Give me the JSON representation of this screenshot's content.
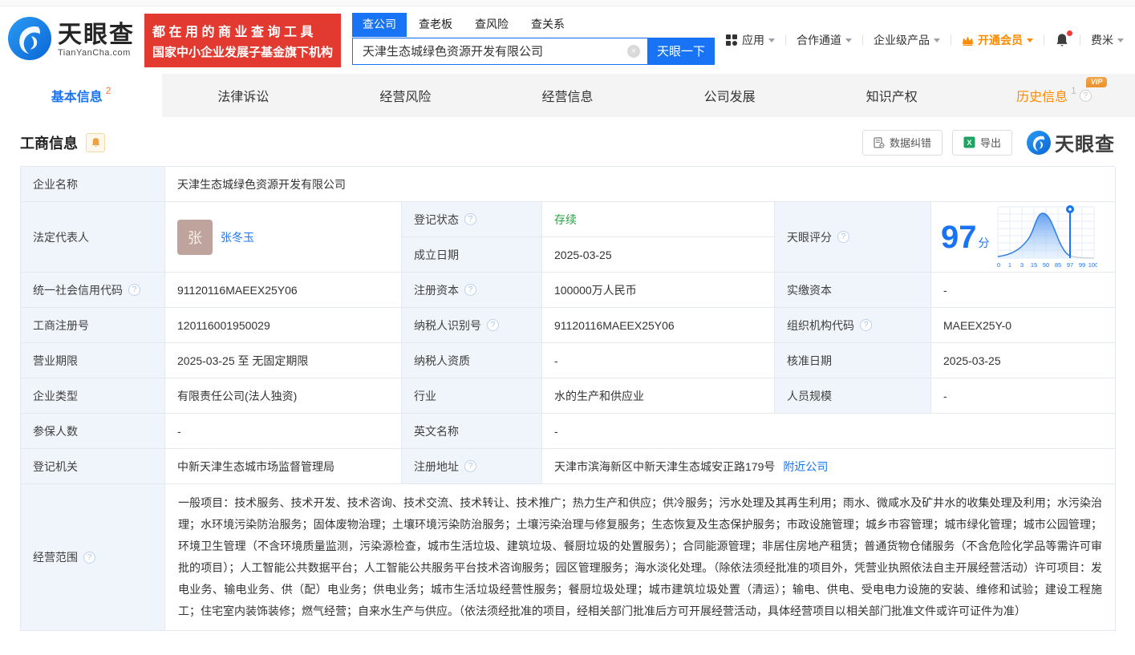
{
  "icons": {
    "help": "?",
    "clear": "×",
    "excel_x": "X"
  },
  "colors": {
    "primary_blue": "#1874f5",
    "banner_red": "#e23a30",
    "status_green": "#2ba245",
    "vip_orange": "#ff8a00",
    "avatar_brown": "#bea49c"
  },
  "header": {
    "brand": {
      "name": "天眼查",
      "domain": "TianYanCha.com"
    },
    "slogan": {
      "line1": "都在用的商业查询工具",
      "line2": "国家中小企业发展子基金旗下机构"
    },
    "search": {
      "tabs": [
        {
          "label": "查公司"
        },
        {
          "label": "查老板"
        },
        {
          "label": "查风险"
        },
        {
          "label": "查关系"
        }
      ],
      "query": "天津生态城绿色资源开发有限公司",
      "submit_label": "天眼一下"
    },
    "nav": {
      "apps": "应用",
      "partner": "合作通道",
      "enterprise": "企业级产品",
      "vip": "开通会员",
      "user": "费米"
    }
  },
  "tabbar": {
    "tabs": [
      {
        "label": "基本信息",
        "count": "2"
      },
      {
        "label": "法律诉讼"
      },
      {
        "label": "经营风险"
      },
      {
        "label": "经营信息"
      },
      {
        "label": "公司发展"
      },
      {
        "label": "知识产权"
      },
      {
        "label": "历史信息",
        "count": "1",
        "badge": "VIP"
      }
    ]
  },
  "section": {
    "title": "工商信息",
    "correct_label": "数据纠错",
    "export_label": "导出",
    "watermark": "天眼查"
  },
  "score": {
    "label": "天眼评分",
    "value": "97",
    "unit": "分",
    "axis": [
      "0",
      "1",
      "3",
      "15",
      "50",
      "85",
      "97",
      "99",
      "100"
    ]
  },
  "chart_data": {
    "type": "area",
    "title": "天眼评分分布曲线",
    "x_tick_labels": [
      "0",
      "1",
      "3",
      "15",
      "50",
      "85",
      "97",
      "99",
      "100"
    ],
    "marker_value": 97,
    "shape": "bell-curve"
  },
  "fields": {
    "company_name": {
      "label": "企业名称",
      "value": "天津生态城绿色资源开发有限公司"
    },
    "legal_rep": {
      "label": "法定代表人",
      "value": "张冬玉",
      "avatar": "张"
    },
    "reg_status": {
      "label": "登记状态",
      "value": "存续"
    },
    "est_date": {
      "label": "成立日期",
      "value": "2025-03-25"
    },
    "credit_code": {
      "label": "统一社会信用代码",
      "value": "91120116MAEEX25Y06"
    },
    "reg_capital": {
      "label": "注册资本",
      "value": "100000万人民币"
    },
    "paid_capital": {
      "label": "实缴资本",
      "value": "-"
    },
    "reg_number": {
      "label": "工商注册号",
      "value": "120116001950029"
    },
    "taxpayer_id": {
      "label": "纳税人识别号",
      "value": "91120116MAEEX25Y06"
    },
    "org_code": {
      "label": "组织机构代码",
      "value": "MAEEX25Y-0"
    },
    "business_term": {
      "label": "营业期限",
      "value": "2025-03-25 至 无固定期限"
    },
    "taxpayer_quality": {
      "label": "纳税人资质",
      "value": "-"
    },
    "approval_date": {
      "label": "核准日期",
      "value": "2025-03-25"
    },
    "company_type": {
      "label": "企业类型",
      "value": "有限责任公司(法人独资)"
    },
    "industry": {
      "label": "行业",
      "value": "水的生产和供应业"
    },
    "staff_size": {
      "label": "人员规模",
      "value": "-"
    },
    "insured_count": {
      "label": "参保人数",
      "value": "-"
    },
    "english_name": {
      "label": "英文名称",
      "value": "-"
    },
    "reg_authority": {
      "label": "登记机关",
      "value": "中新天津生态城市场监督管理局"
    },
    "reg_address": {
      "label": "注册地址",
      "value": "天津市滨海新区中新天津生态城安正路179号",
      "link": "附近公司"
    },
    "business_scope": {
      "label": "经营范围",
      "value": "一般项目：技术服务、技术开发、技术咨询、技术交流、技术转让、技术推广；热力生产和供应；供冷服务；污水处理及其再生利用；雨水、微咸水及矿井水的收集处理及利用；水污染治理；水环境污染防治服务；固体废物治理；土壤环境污染防治服务；土壤污染治理与修复服务；生态恢复及生态保护服务；市政设施管理；城乡市容管理；城市绿化管理；城市公园管理；环境卫生管理（不含环境质量监测，污染源检查，城市生活垃圾、建筑垃圾、餐厨垃圾的处置服务）；合同能源管理；非居住房地产租赁；普通货物仓储服务（不含危险化学品等需许可审批的项目）；人工智能公共数据平台；人工智能公共服务平台技术咨询服务；园区管理服务；海水淡化处理。（除依法须经批准的项目外，凭营业执照依法自主开展经营活动）许可项目：发电业务、输电业务、供（配）电业务；供电业务；城市生活垃圾经营性服务；餐厨垃圾处理；城市建筑垃圾处置（清运）；输电、供电、受电电力设施的安装、维修和试验；建设工程施工；住宅室内装饰装修；燃气经营；自来水生产与供应。（依法须经批准的项目，经相关部门批准后方可开展经营活动，具体经营项目以相关部门批准文件或许可证件为准）"
    }
  }
}
